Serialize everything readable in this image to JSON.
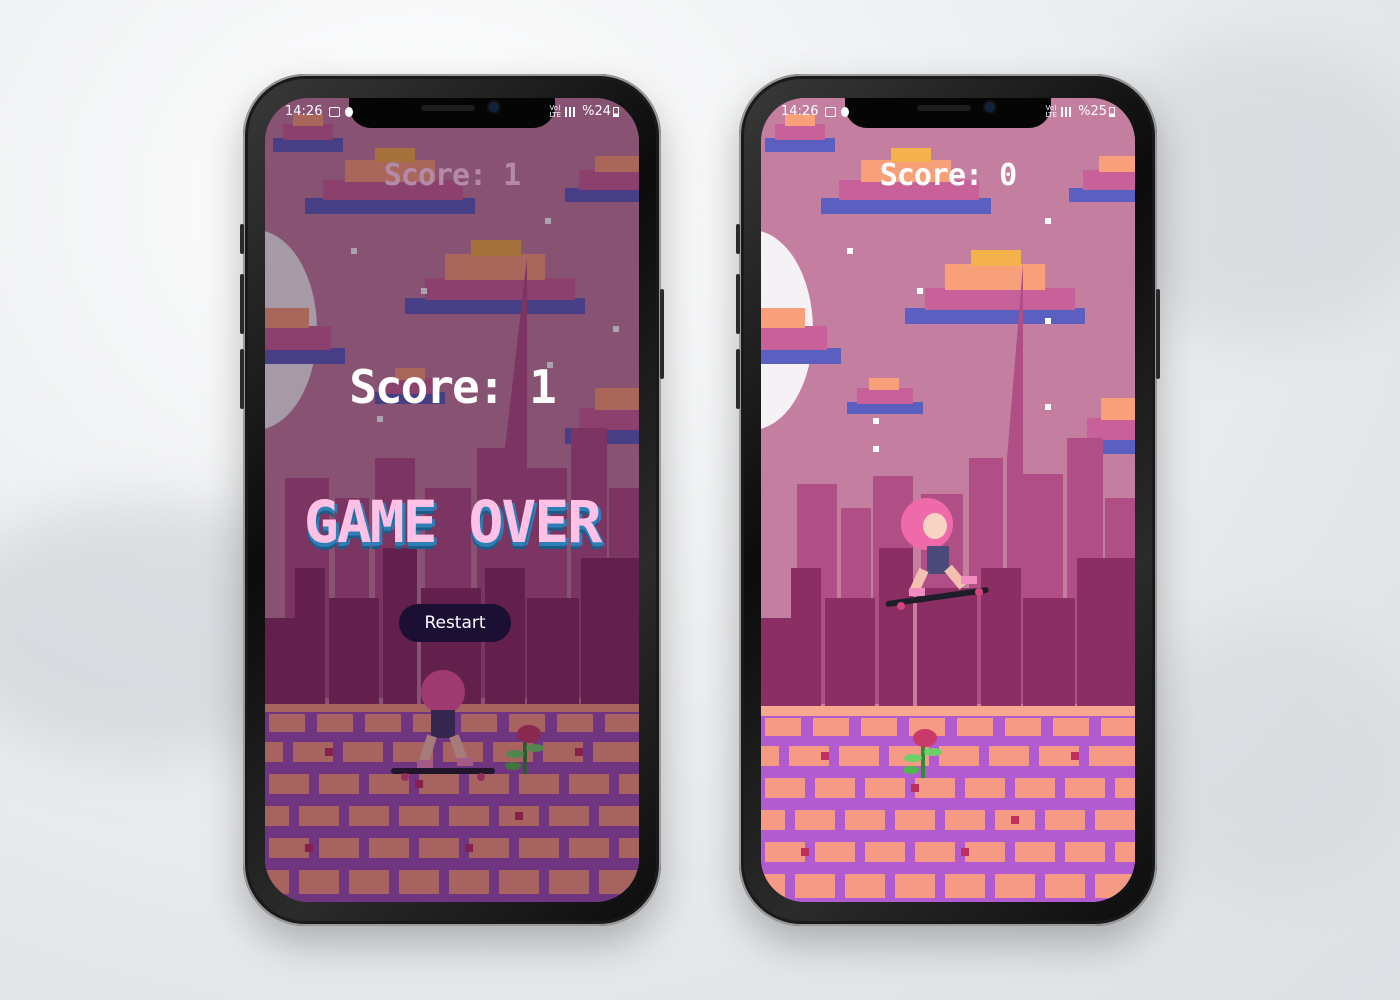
{
  "phones": [
    {
      "status": {
        "time": "14:26",
        "network": "Vo)) LTE",
        "battery": "%24"
      },
      "score_label": "Score: 1",
      "overlay_score": "Score: 1",
      "game_over": "GAME OVER",
      "restart_label": "Restart",
      "state": "game-over"
    },
    {
      "status": {
        "time": "14:26",
        "network": "Vo)) LTE",
        "battery": "%25"
      },
      "score_label": "Score: 0",
      "state": "playing"
    }
  ],
  "colors": {
    "sky": "#c47fa0",
    "sky_dim": "#7a4a68",
    "city_back": "#b04f86",
    "city_front": "#8a2e63",
    "brick": "#f59a84",
    "mortar": "#9d4fb8",
    "cloud_top": "#f7a07a",
    "cloud_mid": "#c8619a",
    "cloud_base": "#5a5fc0",
    "restart_bg": "#1b0f33"
  }
}
